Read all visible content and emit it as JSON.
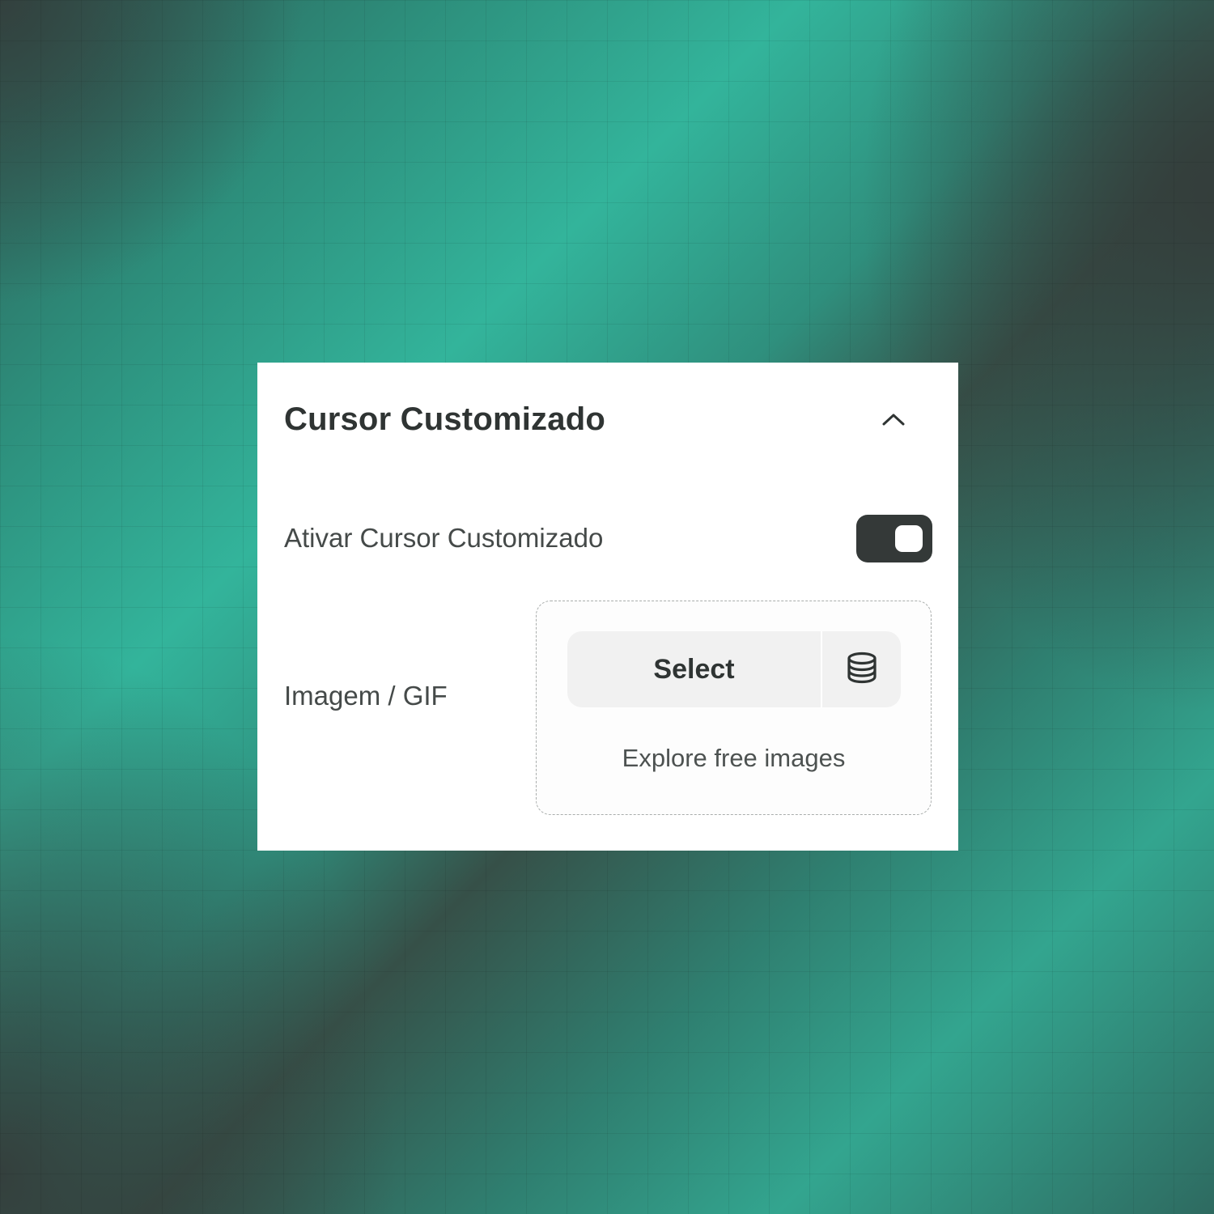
{
  "panel": {
    "title": "Cursor Customizado",
    "collapse_icon": "chevron-up-icon"
  },
  "toggle_row": {
    "label": "Ativar Cursor Customizado",
    "enabled": true,
    "track_color": "#343938"
  },
  "image_row": {
    "label": "Imagem / GIF",
    "select_label": "Select",
    "library_icon": "database-icon",
    "explore_label": "Explore free images"
  },
  "colors": {
    "background_accent": "#33b49b",
    "background_dark": "#343c3a",
    "text_primary": "#2f3433"
  }
}
